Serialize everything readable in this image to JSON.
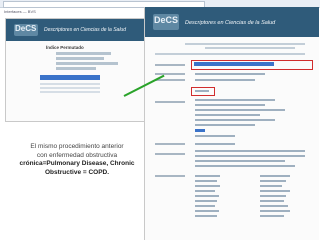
{
  "browser": {
    "tab_text": "Interfaces — BVS"
  },
  "left_window": {
    "header_brand": "DeCS",
    "header_title": "Descriptores en Ciencias de la Salud",
    "panel_title": "Índice Permutado"
  },
  "right_window": {
    "header_brand": "DeCS",
    "header_title": "Descriptores en Ciencias de la Salud",
    "selected_term": "Enfermedad Pulmonar Obstructiva Crónica",
    "highlighted_result": "COPD"
  },
  "caption": {
    "line1": "El mismo procedimiento anterior",
    "line2": "con enfermedad obstructiva",
    "line3": "crónica=Pulmonary Disease, Chronic",
    "line4": "Obstructive = COPD."
  },
  "colors": {
    "header_blue": "#2f5b7a",
    "highlight_blue": "#3b73c9",
    "annotation_red": "#d12d2d",
    "arrow_green": "#2aa32a"
  }
}
